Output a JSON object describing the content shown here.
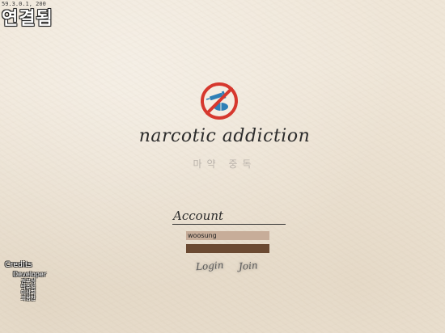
{
  "status": {
    "ip": "59.3.0.1, 200",
    "text": "연결됨"
  },
  "title": {
    "en": "narcotic addiction",
    "ko": "마약 중독"
  },
  "login": {
    "account_label": "Account",
    "account_value": "woosung",
    "login_label": "Login",
    "join_label": "Join"
  },
  "credits": {
    "title": "Credits",
    "role": "Developer",
    "names": [
      "권우성",
      "박준일",
      "이상희",
      "최용찬"
    ]
  },
  "icons": {
    "logo": "no-drugs-icon"
  },
  "colors": {
    "background": "#efe6d8",
    "account_field": "#c7ad99",
    "password_field": "#6b4a32",
    "logo_red": "#d6382e",
    "logo_blue": "#2f7fb6"
  }
}
